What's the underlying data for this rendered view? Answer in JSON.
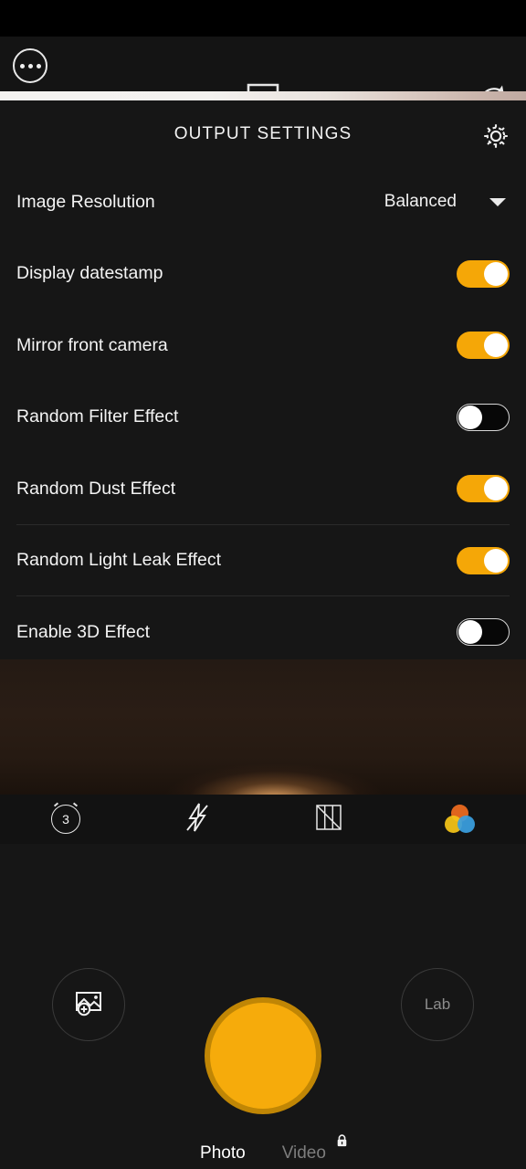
{
  "app": {
    "accent_color": "#f5a707",
    "shutter_color": "#f6ab0b",
    "shutter_ring_color": "#c08605",
    "panel_bg": "#161616"
  },
  "top_bar": {
    "more_icon": "more-dots-icon",
    "crop_icon": "crop-frame-icon",
    "flip_icon": "camera-flip-icon"
  },
  "settings": {
    "title": "OUTPUT SETTINGS",
    "gear_icon": "gear-icon",
    "rows": [
      {
        "label": "Image Resolution",
        "type": "select",
        "value": "Balanced",
        "caret_icon": "chevron-down-icon",
        "divider": false
      },
      {
        "label": "Display datestamp",
        "type": "toggle",
        "state": "on",
        "divider": false
      },
      {
        "label": "Mirror front camera",
        "type": "toggle",
        "state": "on",
        "divider": false
      },
      {
        "label": "Random Filter Effect",
        "type": "toggle",
        "state": "off",
        "divider": false
      },
      {
        "label": "Random Dust Effect",
        "type": "toggle",
        "state": "on",
        "divider": true
      },
      {
        "label": "Random Light Leak Effect",
        "type": "toggle",
        "state": "on",
        "divider": true
      },
      {
        "label": "Enable 3D Effect",
        "type": "toggle",
        "state": "off",
        "divider": false
      }
    ]
  },
  "quick_bar": {
    "items": [
      {
        "name": "timer-icon",
        "value": "3"
      },
      {
        "name": "flash-off-icon",
        "value": ""
      },
      {
        "name": "grid-overlay-icon",
        "value": ""
      },
      {
        "name": "color-filter-icon",
        "value": ""
      }
    ]
  },
  "controls": {
    "gallery_icon": "gallery-add-icon",
    "lab_label": "Lab",
    "shutter_icon": "shutter-button"
  },
  "mode_tabs": {
    "items": [
      {
        "label": "Photo",
        "active": true,
        "locked": false
      },
      {
        "label": "Video",
        "active": false,
        "locked": true
      }
    ],
    "lock_icon": "lock-icon"
  }
}
